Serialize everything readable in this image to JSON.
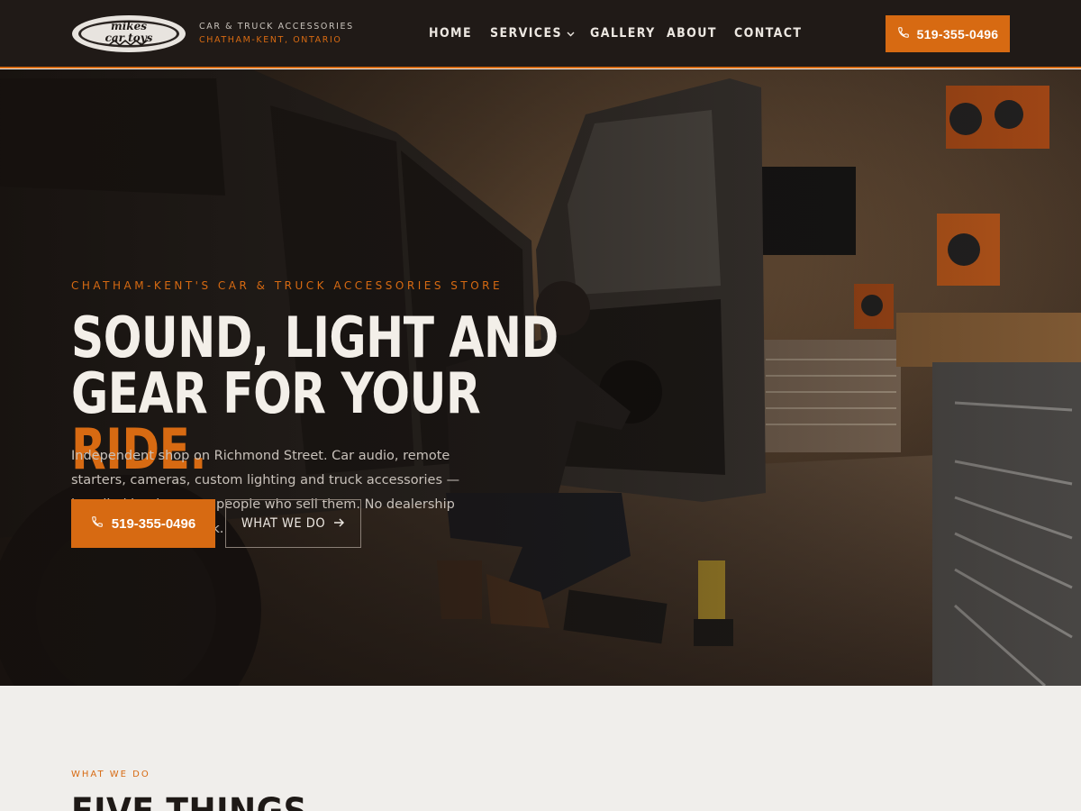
{
  "brand": {
    "logo_wordmark": "mikes car toys",
    "tagline": "CAR & TRUCK ACCESSORIES",
    "location": "CHATHAM-KENT, ONTARIO"
  },
  "nav": {
    "items": [
      "HOME",
      "SERVICES",
      "GALLERY",
      "ABOUT",
      "CONTACT"
    ],
    "phone": "519-355-0496"
  },
  "hero": {
    "kicker": "CHATHAM-KENT'S CAR & TRUCK ACCESSORIES STORE",
    "headline_line1": "SOUND, LIGHT AND",
    "headline_line2_prefix": "GEAR FOR YOUR ",
    "headline_line2_accent": "RIDE.",
    "lede": "Independent shop on Richmond Street. Car audio, remote starters, cameras, custom lighting and truck accessories — installed by the same people who sell them. No dealership markup, no guesswork.",
    "primary_cta": "519-355-0496",
    "secondary_cta": "WHAT WE DO"
  },
  "section": {
    "kicker": "WHAT WE DO",
    "title": "FIVE THINGS"
  },
  "colors": {
    "accent": "#d76a12",
    "header_bg": "#201a17",
    "section_bg": "#f0eeeb"
  },
  "icons": {
    "phone": "phone-icon",
    "arrow": "arrow-right-icon",
    "chevron": "chevron-down-icon"
  }
}
